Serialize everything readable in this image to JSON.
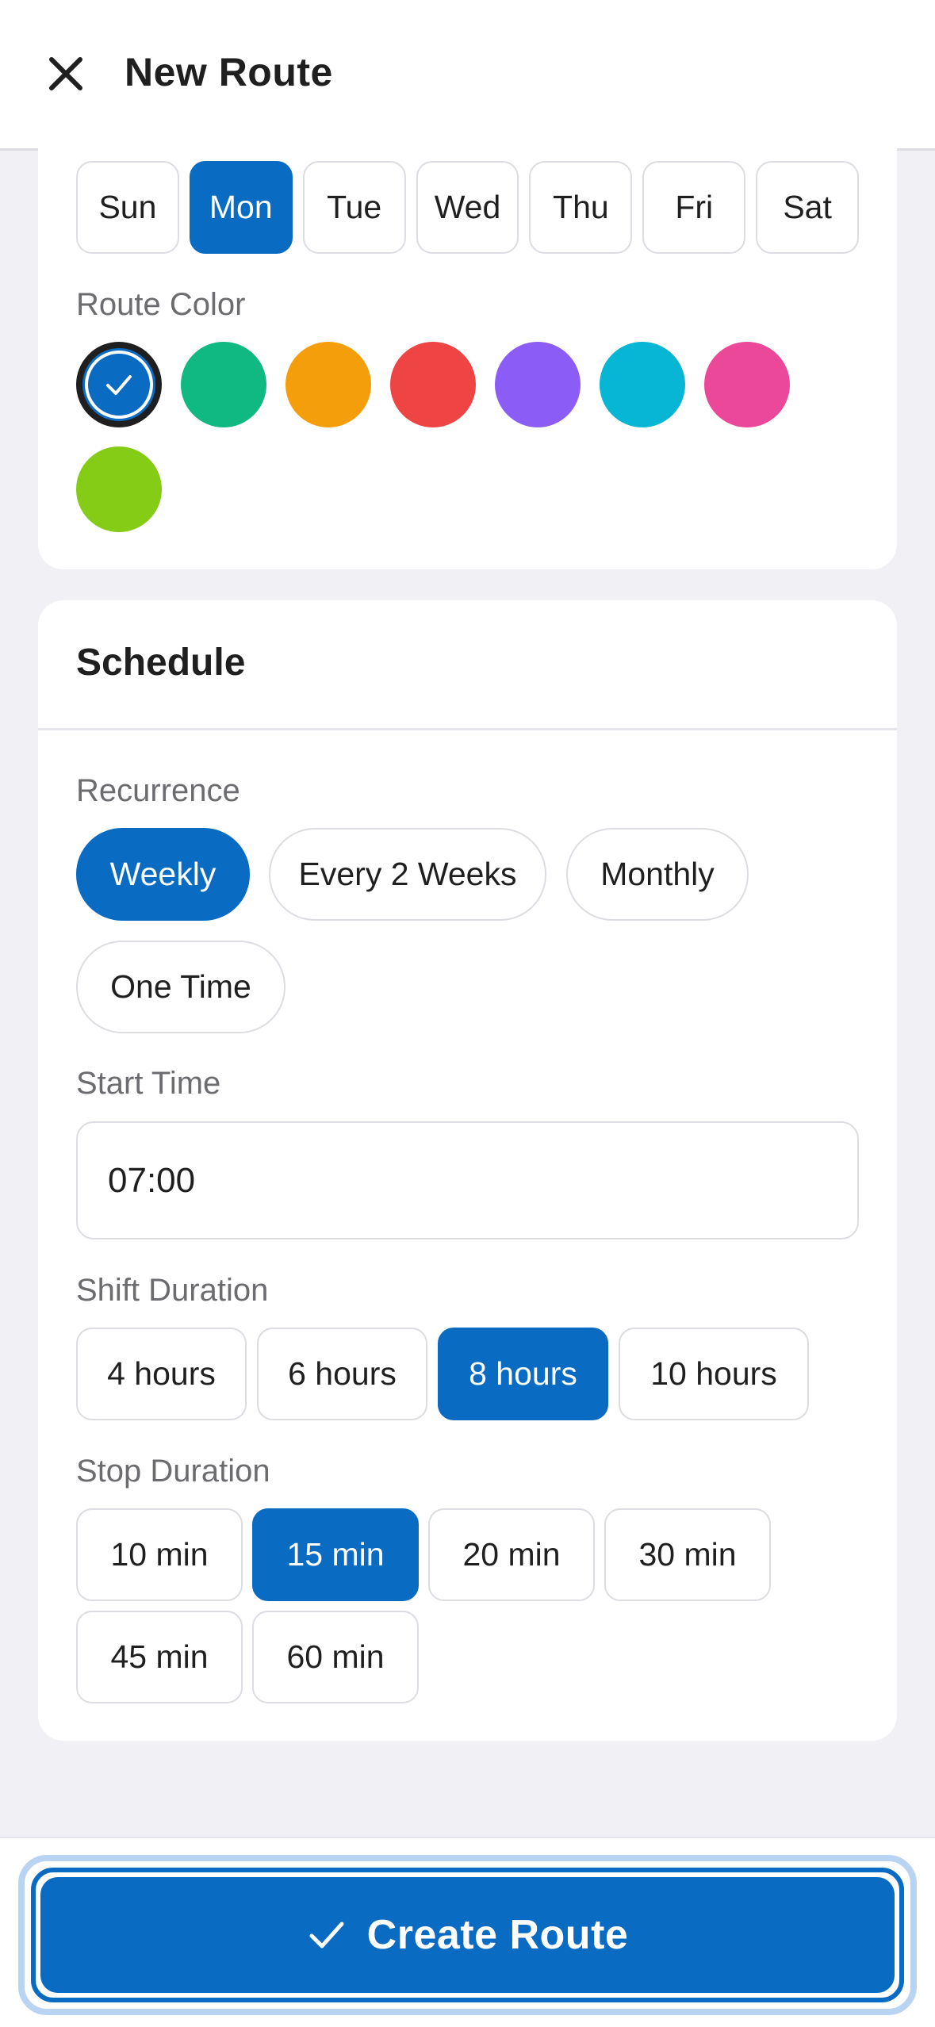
{
  "header": {
    "title": "New Route",
    "close_icon": "close-icon"
  },
  "days": [
    {
      "label": "Sun",
      "selected": false
    },
    {
      "label": "Mon",
      "selected": true
    },
    {
      "label": "Tue",
      "selected": false
    },
    {
      "label": "Wed",
      "selected": false
    },
    {
      "label": "Thu",
      "selected": false
    },
    {
      "label": "Fri",
      "selected": false
    },
    {
      "label": "Sat",
      "selected": false
    }
  ],
  "route_color": {
    "label": "Route Color",
    "colors": [
      "#0a6bc3",
      "#10b981",
      "#f59e0b",
      "#ef4444",
      "#8b5cf6",
      "#06b6d4",
      "#ec4899",
      "#84cc16"
    ],
    "selected_index": 0
  },
  "schedule": {
    "title": "Schedule",
    "recurrence": {
      "label": "Recurrence",
      "options": [
        "Weekly",
        "Every 2 Weeks",
        "Monthly",
        "One Time"
      ],
      "selected": "Weekly"
    },
    "start_time": {
      "label": "Start Time",
      "value": "07:00"
    },
    "shift_duration": {
      "label": "Shift Duration",
      "options": [
        "4 hours",
        "6 hours",
        "8 hours",
        "10 hours"
      ],
      "selected": "8 hours"
    },
    "stop_duration": {
      "label": "Stop Duration",
      "options": [
        "10 min",
        "15 min",
        "20 min",
        "30 min",
        "45 min",
        "60 min"
      ],
      "selected": "15 min"
    }
  },
  "footer": {
    "create_label": "Create Route",
    "check_icon": "check-icon"
  },
  "accent_color": "#0a6bc3"
}
